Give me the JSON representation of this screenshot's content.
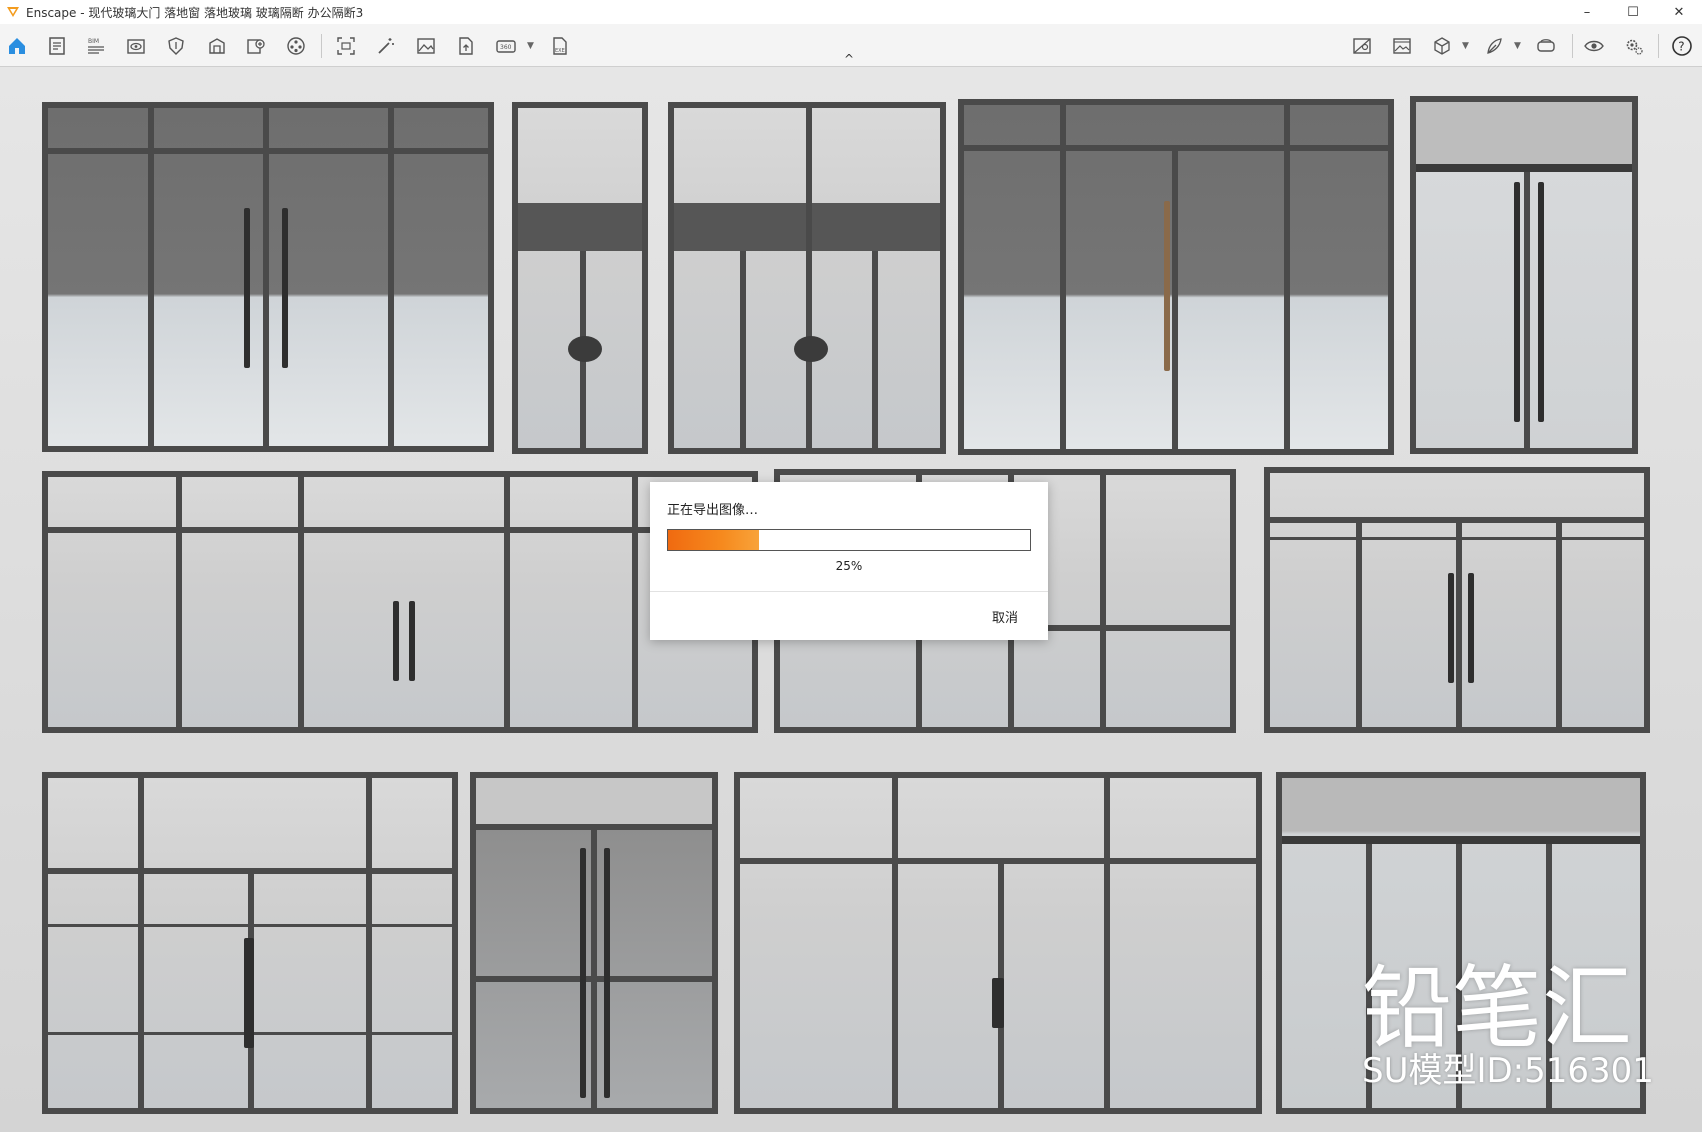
{
  "window": {
    "title": "Enscape - 现代玻璃大门 落地窗 落地玻璃 玻璃隔断 办公隔断3",
    "minimize": "–",
    "maximize": "☐",
    "close": "✕"
  },
  "toolbar": {
    "buttons": [
      {
        "name": "home-icon"
      },
      {
        "name": "document-icon"
      },
      {
        "name": "bim-icon"
      },
      {
        "name": "eye-view-icon"
      },
      {
        "name": "shield-icon"
      },
      {
        "name": "material-icon"
      },
      {
        "name": "add-view-icon"
      },
      {
        "name": "film-reel-icon"
      },
      {
        "name": "screenshot-icon"
      },
      {
        "name": "magic-wand-icon"
      },
      {
        "name": "image-icon"
      },
      {
        "name": "upload-file-icon"
      },
      {
        "name": "panorama-360-icon"
      },
      {
        "name": "export-exe-icon"
      },
      {
        "name": "map-icon"
      },
      {
        "name": "gallery-icon"
      },
      {
        "name": "cube-icon"
      },
      {
        "name": "feather-icon"
      },
      {
        "name": "vr-headset-icon"
      },
      {
        "name": "visibility-icon"
      },
      {
        "name": "settings-icon"
      },
      {
        "name": "help-icon"
      }
    ],
    "collapse_glyph": "^",
    "help_glyph": "?"
  },
  "dialog": {
    "title": "正在导出图像…",
    "progress": 25,
    "progress_label": "25%",
    "cancel_label": "取消"
  },
  "overlay": {
    "brand": "铅笔汇",
    "model_id": "SU模型ID:516301"
  },
  "colors": {
    "accent": "#f06a10",
    "frame": "#4a4a4a",
    "home_icon": "#2a8ee0"
  }
}
